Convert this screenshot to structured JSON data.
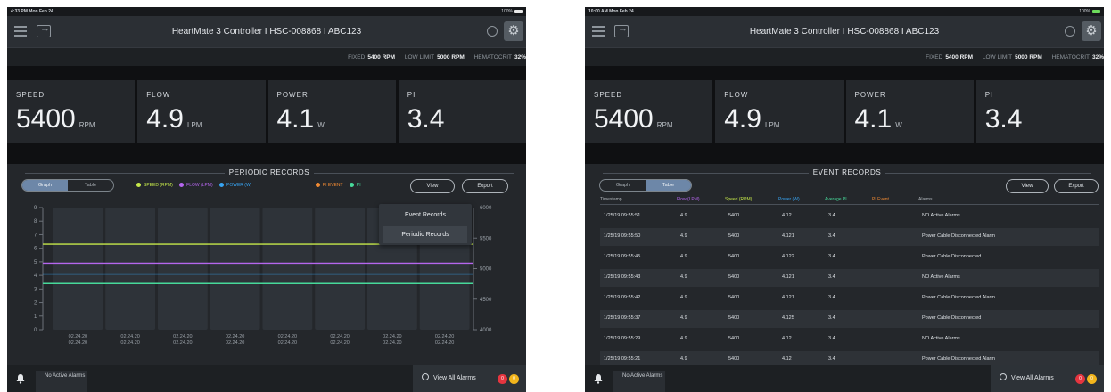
{
  "left": {
    "status": {
      "time": "4:33 PM  Mon Feb 24",
      "battery": "100%"
    },
    "title": "HeartMate 3 Controller I HSC-008868 I ABC123",
    "limits": {
      "fixed_label": "FIXED",
      "fixed_value": "5400 RPM",
      "low_label": "LOW LIMIT",
      "low_value": "5000 RPM",
      "hct_label": "HEMATOCRIT",
      "hct_value": "32%"
    },
    "metrics": [
      {
        "label": "SPEED",
        "value": "5400",
        "unit": "RPM"
      },
      {
        "label": "FLOW",
        "value": "4.9",
        "unit": "LPM"
      },
      {
        "label": "POWER",
        "value": "4.1",
        "unit": "W"
      },
      {
        "label": "PI",
        "value": "3.4",
        "unit": ""
      }
    ],
    "section_title": "PERIODIC RECORDS",
    "tabs": [
      "Graph",
      "Table"
    ],
    "legend": [
      {
        "label": "SPEED (RPM)",
        "color": "#c6e94a"
      },
      {
        "label": "FLOW (LPM)",
        "color": "#b566ee"
      },
      {
        "label": "POWER (W)",
        "color": "#37a4f2"
      },
      {
        "label": "PI EVENT",
        "color": "#f08a33"
      },
      {
        "label": "PI",
        "color": "#47d99a"
      }
    ],
    "view_label": "View",
    "export_label": "Export",
    "menu": [
      "Event Records",
      "Periodic Records"
    ],
    "chart_data": {
      "type": "line",
      "left_ticks": [
        "9",
        "8",
        "7",
        "6",
        "5",
        "4",
        "3",
        "2",
        "1",
        "0"
      ],
      "right_ticks": [
        "5500",
        "5000",
        "4500",
        "4000"
      ],
      "right_top_tick": "6000",
      "x_labels": [
        [
          "02.24.20",
          "02.24.20"
        ],
        [
          "02.24.20",
          "02.24.20"
        ],
        [
          "02.24.20",
          "02.24.20"
        ],
        [
          "02.24.20",
          "02.24.20"
        ],
        [
          "02.24.20",
          "02.24.20"
        ],
        [
          "02.24.20",
          "02.24.20"
        ],
        [
          "02.24.20",
          "02.24.20"
        ],
        [
          "02.24.20",
          "02.24.20"
        ]
      ],
      "series": [
        {
          "name": "SPEED (RPM)",
          "color": "#c6e94a",
          "axis": "right",
          "value": 5400
        },
        {
          "name": "FLOW (LPM)",
          "color": "#b566ee",
          "axis": "left",
          "value": 4.9
        },
        {
          "name": "POWER (W)",
          "color": "#37a4f2",
          "axis": "left",
          "value": 4.1
        },
        {
          "name": "PI",
          "color": "#47d99a",
          "axis": "left",
          "value": 3.4
        }
      ],
      "ylim_left": [
        0,
        9
      ],
      "ylim_right": [
        4000,
        6000
      ]
    },
    "footer": {
      "no_active": "No Active Alarms",
      "view_all": "View All Alarms",
      "badge_red": "0",
      "badge_yellow": "0"
    }
  },
  "right": {
    "status": {
      "time": "10:00 AM  Mon Feb 24",
      "battery": "100%"
    },
    "title": "HeartMate 3 Controller I HSC-008868 I ABC123",
    "limits": {
      "fixed_label": "FIXED",
      "fixed_value": "5400 RPM",
      "low_label": "LOW LIMIT",
      "low_value": "5000 RPM",
      "hct_label": "HEMATOCRIT",
      "hct_value": "32%"
    },
    "metrics": [
      {
        "label": "SPEED",
        "value": "5400",
        "unit": "RPM"
      },
      {
        "label": "FLOW",
        "value": "4.9",
        "unit": "LPM"
      },
      {
        "label": "POWER",
        "value": "4.1",
        "unit": "W"
      },
      {
        "label": "PI",
        "value": "3.4",
        "unit": ""
      }
    ],
    "section_title": "EVENT RECORDS",
    "tabs": [
      "Graph",
      "Table"
    ],
    "view_label": "View",
    "export_label": "Export",
    "columns": [
      {
        "label": "Timestamp",
        "color": "#aeb4ba"
      },
      {
        "label": "Flow (LPM)",
        "color": "#b566ee"
      },
      {
        "label": "Speed (RPM)",
        "color": "#c6e94a"
      },
      {
        "label": "Power (W)",
        "color": "#37a4f2"
      },
      {
        "label": "Average PI",
        "color": "#47d99a"
      },
      {
        "label": "PI Event",
        "color": "#f08a33"
      },
      {
        "label": "Alarms",
        "color": "#aeb4ba"
      }
    ],
    "rows": [
      [
        "1/25/19 09:55:51",
        "4.9",
        "5400",
        "4.12",
        "3.4",
        "",
        "NO Active Alarms"
      ],
      [
        "1/25/19 09:55:50",
        "4.9",
        "5400",
        "4.121",
        "3.4",
        "",
        "Power Cable Disconnected Alarm"
      ],
      [
        "1/25/19 09:55:45",
        "4.9",
        "5400",
        "4.122",
        "3.4",
        "",
        "Power Cable Disconnected"
      ],
      [
        "1/25/19 09:55:43",
        "4.9",
        "5400",
        "4.121",
        "3.4",
        "",
        "NO Active Alarms"
      ],
      [
        "1/25/19 09:55:42",
        "4.9",
        "5400",
        "4.121",
        "3.4",
        "",
        "Power Cable Disconnected Alarm"
      ],
      [
        "1/25/19 09:55:37",
        "4.9",
        "5400",
        "4.125",
        "3.4",
        "",
        "Power Cable Disconnected"
      ],
      [
        "1/25/19 09:55:29",
        "4.9",
        "5400",
        "4.12",
        "3.4",
        "",
        "NO Active Alarms"
      ],
      [
        "1/25/19 09:55:21",
        "4.9",
        "5400",
        "4.12",
        "3.4",
        "",
        "Power Cable Disconnected Alarm"
      ]
    ],
    "footer": {
      "no_active": "No Active Alarms",
      "view_all": "View All Alarms",
      "badge_red": "0",
      "badge_yellow": "0"
    }
  }
}
